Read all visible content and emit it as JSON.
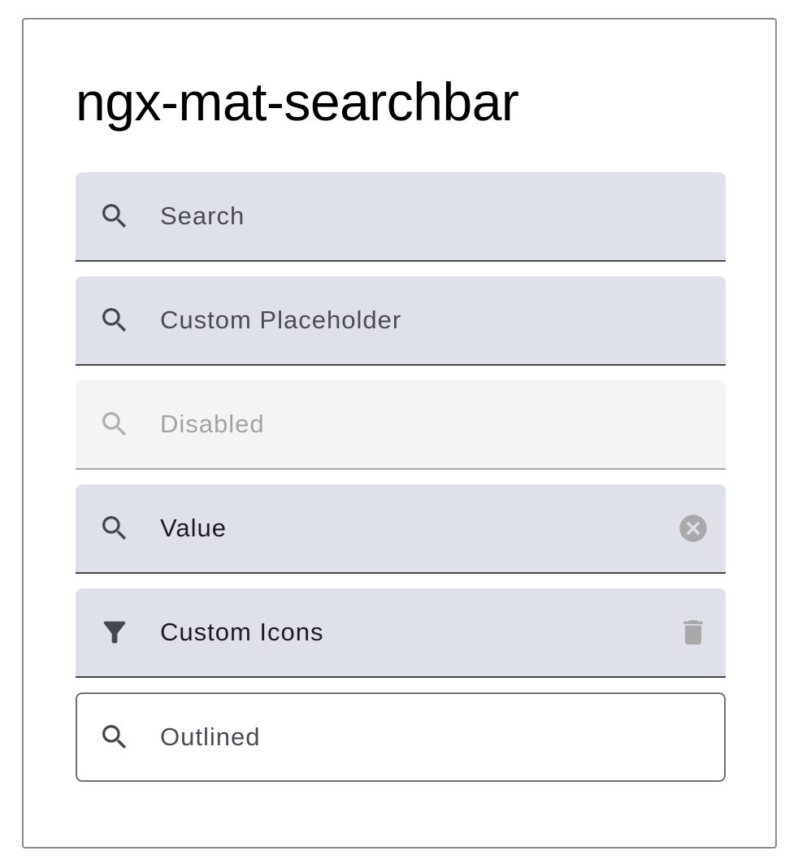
{
  "page": {
    "title": "ngx-mat-searchbar"
  },
  "colors": {
    "field_fill": "#dfe1ea",
    "disabled_fill": "#f4f4f5",
    "icon_dark": "#44474f",
    "icon_disabled": "#b0b0b0",
    "action_icon_grey": "#a9a9a9"
  },
  "searchbars": [
    {
      "variant": "filled",
      "leading_icon": "search-icon",
      "placeholder": "Search",
      "value": "",
      "disabled": false
    },
    {
      "variant": "filled",
      "leading_icon": "search-icon",
      "placeholder": "Custom Placeholder",
      "value": "",
      "disabled": false
    },
    {
      "variant": "filled",
      "leading_icon": "search-icon",
      "placeholder": "Disabled",
      "value": "",
      "disabled": true
    },
    {
      "variant": "filled",
      "leading_icon": "search-icon",
      "placeholder": "",
      "value": "Value",
      "disabled": false,
      "trailing_icon": "clear-circle-icon"
    },
    {
      "variant": "filled",
      "leading_icon": "filter-icon",
      "placeholder": "",
      "value": "Custom Icons",
      "disabled": false,
      "trailing_icon": "trash-icon"
    },
    {
      "variant": "outlined",
      "leading_icon": "search-icon",
      "placeholder": "Outlined",
      "value": "",
      "disabled": false
    }
  ]
}
